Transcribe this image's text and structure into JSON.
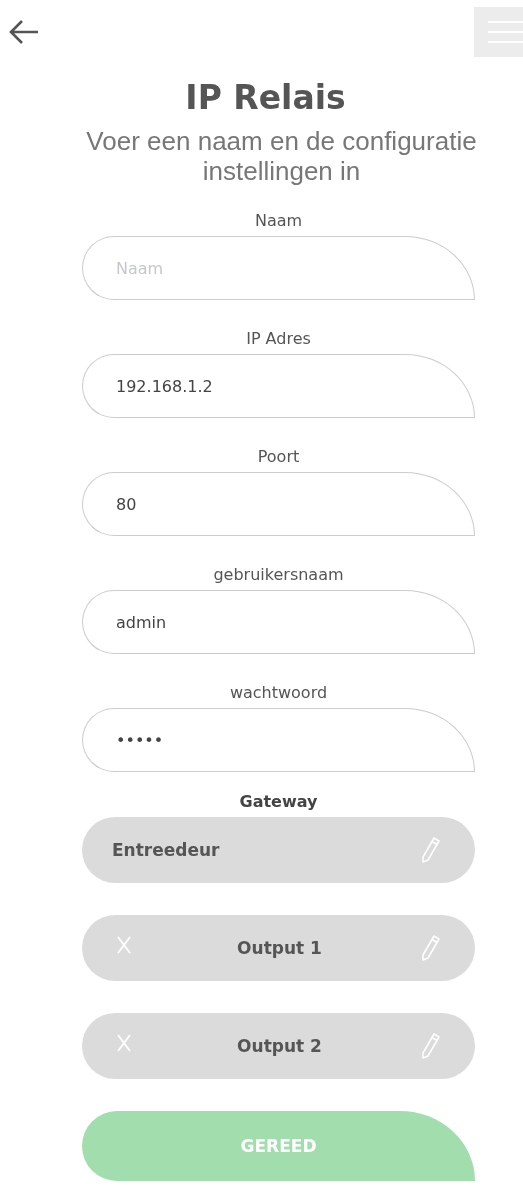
{
  "title": "IP Relais",
  "subtitle": "Voer een naam en de configuratie instellingen in",
  "fields": [
    {
      "label": "Naam",
      "placeholder": "Naam"
    },
    {
      "label": "IP Adres",
      "value": "192.168.1.2"
    },
    {
      "label": "Poort",
      "value": "80"
    },
    {
      "label": "gebruikersnaam",
      "value": "admin"
    },
    {
      "label": "wachtwoord",
      "value": "•••••"
    }
  ],
  "gateway": {
    "heading": "Gateway",
    "items": [
      {
        "label": "Entreedeur",
        "removable": false
      },
      {
        "label": "Output 1",
        "removable": true
      },
      {
        "label": "Output 2",
        "removable": true
      }
    ]
  },
  "done_button": "GEREED"
}
